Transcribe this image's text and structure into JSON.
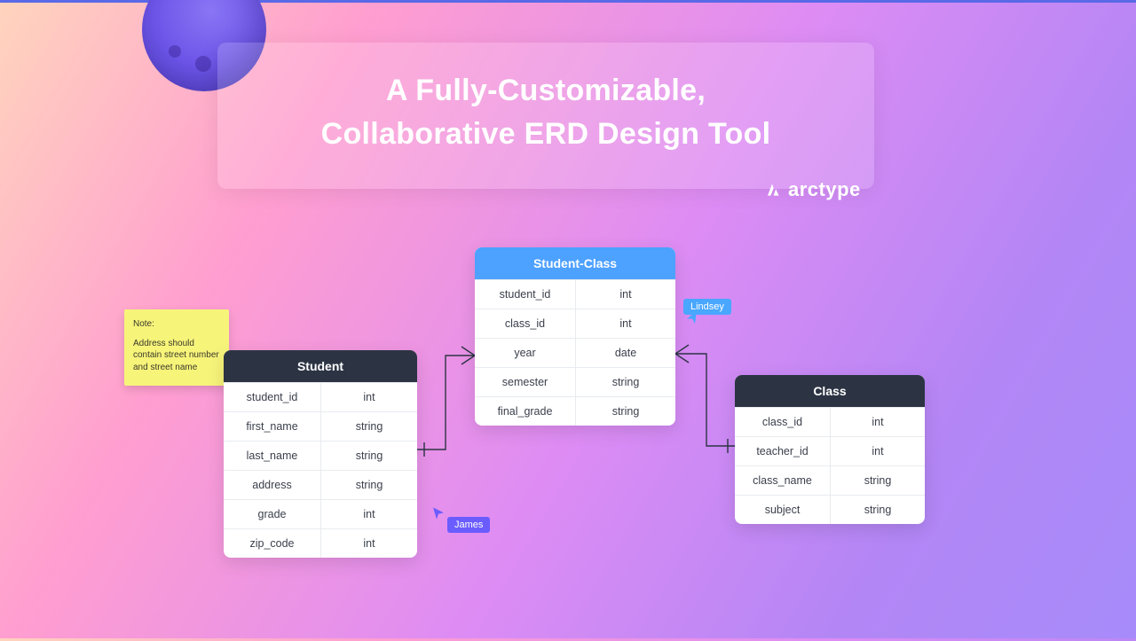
{
  "headline": {
    "line1": "A Fully-Customizable,",
    "line2": "Collaborative ERD Design Tool"
  },
  "brand": {
    "name": "arctype"
  },
  "note": {
    "title": "Note:",
    "body": "Address should contain street number and street name"
  },
  "cursors": {
    "james": {
      "label": "James"
    },
    "lindsey": {
      "label": "Lindsey"
    }
  },
  "entities": {
    "student": {
      "title": "Student",
      "fields": [
        {
          "name": "student_id",
          "type": "int"
        },
        {
          "name": "first_name",
          "type": "string"
        },
        {
          "name": "last_name",
          "type": "string"
        },
        {
          "name": "address",
          "type": "string"
        },
        {
          "name": "grade",
          "type": "int"
        },
        {
          "name": "zip_code",
          "type": "int"
        }
      ]
    },
    "student_class": {
      "title": "Student-Class",
      "fields": [
        {
          "name": "student_id",
          "type": "int"
        },
        {
          "name": "class_id",
          "type": "int"
        },
        {
          "name": "year",
          "type": "date"
        },
        {
          "name": "semester",
          "type": "string"
        },
        {
          "name": "final_grade",
          "type": "string"
        }
      ]
    },
    "class": {
      "title": "Class",
      "fields": [
        {
          "name": "class_id",
          "type": "int"
        },
        {
          "name": "teacher_id",
          "type": "int"
        },
        {
          "name": "class_name",
          "type": "string"
        },
        {
          "name": "subject",
          "type": "string"
        }
      ]
    }
  },
  "chart_data": {
    "type": "erd",
    "entities": [
      {
        "id": "student",
        "title": "Student",
        "fields": [
          {
            "name": "student_id",
            "type": "int"
          },
          {
            "name": "first_name",
            "type": "string"
          },
          {
            "name": "last_name",
            "type": "string"
          },
          {
            "name": "address",
            "type": "string"
          },
          {
            "name": "grade",
            "type": "int"
          },
          {
            "name": "zip_code",
            "type": "int"
          }
        ]
      },
      {
        "id": "student_class",
        "title": "Student-Class",
        "fields": [
          {
            "name": "student_id",
            "type": "int"
          },
          {
            "name": "class_id",
            "type": "int"
          },
          {
            "name": "year",
            "type": "date"
          },
          {
            "name": "semester",
            "type": "string"
          },
          {
            "name": "final_grade",
            "type": "string"
          }
        ]
      },
      {
        "id": "class",
        "title": "Class",
        "fields": [
          {
            "name": "class_id",
            "type": "int"
          },
          {
            "name": "teacher_id",
            "type": "int"
          },
          {
            "name": "class_name",
            "type": "string"
          },
          {
            "name": "subject",
            "type": "string"
          }
        ]
      }
    ],
    "relationships": [
      {
        "from": "student",
        "to": "student_class",
        "from_card": "one",
        "to_card": "many"
      },
      {
        "from": "class",
        "to": "student_class",
        "from_card": "one",
        "to_card": "many"
      }
    ]
  }
}
